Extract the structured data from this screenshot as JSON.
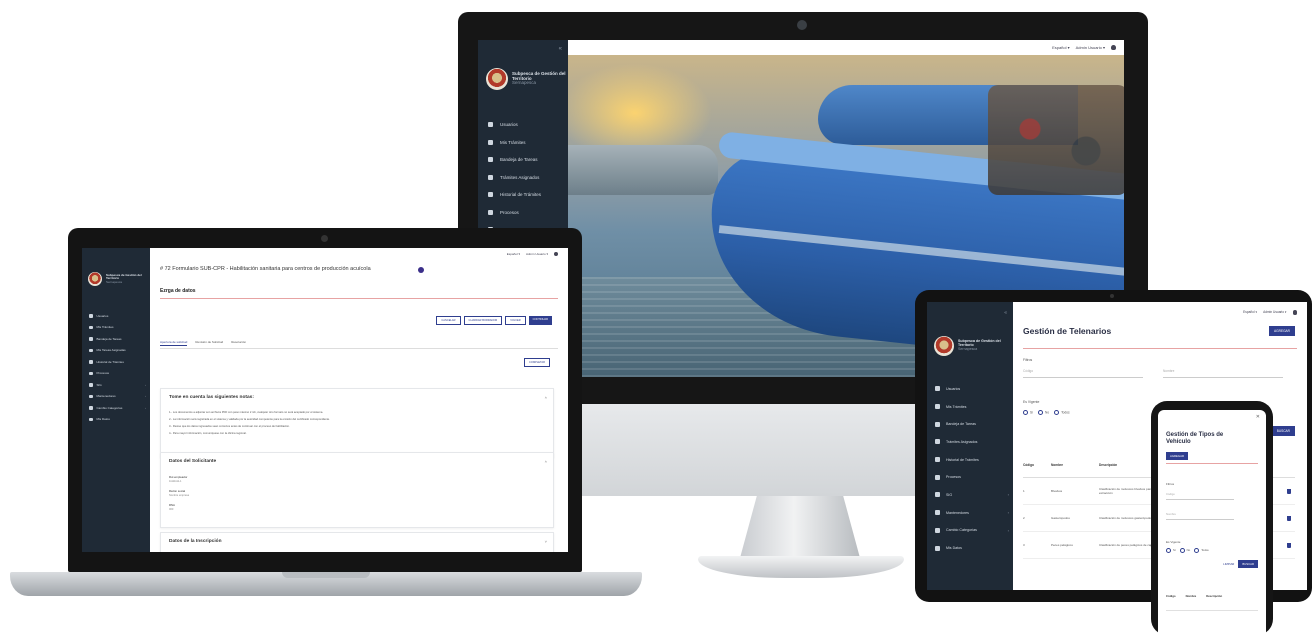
{
  "colors": {
    "sidebar": "#1f2a36",
    "primary": "#2f3e8f",
    "accent_line": "#e7a3a3"
  },
  "brand": {
    "title": "Subpesca de Gestión del Territorio",
    "sub": "Sernapesca"
  },
  "monitor": {
    "topbar": {
      "lang": "Español ▾",
      "user": "Admin Usuario ▾"
    },
    "menu": [
      {
        "label": "Usuarios",
        "icon": "users-icon"
      },
      {
        "label": "Mis Trámites",
        "icon": "documents-icon"
      },
      {
        "label": "Bandeja de Tareas",
        "icon": "inbox-icon"
      },
      {
        "label": "Trámites Asignados",
        "icon": "assigned-icon"
      },
      {
        "label": "Historial de Trámites",
        "icon": "history-icon"
      },
      {
        "label": "Procesos",
        "icon": "process-icon"
      },
      {
        "label": "SIG",
        "icon": "map-icon"
      }
    ]
  },
  "laptop": {
    "topbar": {
      "lang": "Español ▾",
      "user": "Admin Usuario ▾"
    },
    "menu": [
      {
        "label": "Usuarios"
      },
      {
        "label": "Mis Trámites"
      },
      {
        "label": "Bandeja de Tareas"
      },
      {
        "label": "Mis Tareas Asignadas"
      },
      {
        "label": "Historial de Trámites"
      },
      {
        "label": "Procesos"
      },
      {
        "label": "SIG"
      },
      {
        "label": "Mantenedores"
      },
      {
        "label": "Cambio Categorías"
      },
      {
        "label": "Mis Datos"
      }
    ],
    "title": "# 72 Formulario SUB-CPR - Habilitación sanitaria para centros de producción acuícola",
    "subtitle": "Ezrga de datos",
    "actions": [
      "CANCELAR",
      "GUARDAR BORRADOR",
      "VOLVER",
      "CONTINUAR"
    ],
    "tabs": [
      "Apertura de solicitud",
      "Revisión de Solicitud",
      "Resolución"
    ],
    "small_button": "COMPLETAR",
    "notes_panel": {
      "title": "Tome en cuenta las siguientes notas:",
      "lines": [
        "1.- Los documentos a adjuntar son archivos PDF con peso máximo 2 mb, cualquier otro formato no será aceptado por el sistema.",
        "2.- La información será registrada en el sistema y validada por la autoridad competente para la emisión del certificado correspondiente.",
        "3.- Revise que los datos ingresados sean correctos antes de continuar con el proceso de habilitación.",
        "4.- Para mayor información, comuníquese con la oficina regional."
      ]
    },
    "applicant_panel": {
      "title": "Datos del Solicitante",
      "fields": [
        {
          "label": "Rut empleador",
          "value": "11111111-1"
        },
        {
          "label": "Razón social",
          "value": "Nombre empresa"
        },
        {
          "label": "RNA",
          "value": "000"
        }
      ]
    },
    "inscription_panel": {
      "title": "Datos de la Inscripción"
    }
  },
  "tablet": {
    "topbar": {
      "lang": "Español ▾",
      "user": "Admin Usuario ▾"
    },
    "menu": [
      {
        "label": "Usuarios"
      },
      {
        "label": "Mis Trámites"
      },
      {
        "label": "Bandeja de Tareas"
      },
      {
        "label": "Trámites Asignados"
      },
      {
        "label": "Historial de Trámites"
      },
      {
        "label": "Procesos"
      },
      {
        "label": "SIG"
      },
      {
        "label": "Mantenedores"
      },
      {
        "label": "Cambio Categorías"
      },
      {
        "label": "Mis Datos"
      }
    ],
    "title": "Gestión de Telenarios",
    "new_button": "AGREGAR",
    "filter_label": "Filtros",
    "inputs": [
      "Código",
      "Nombre"
    ],
    "radio_label": "Es Vigente",
    "radios": [
      "Sí",
      "No",
      "Todos"
    ],
    "search_button": "BUSCAR",
    "columns": [
      "Código",
      "Nombre",
      "Descripción"
    ],
    "rows": [
      {
        "code": "1",
        "name": "Bivalvos",
        "desc": "Clasificación de moluscos bivalvos para extracción"
      },
      {
        "code": "2",
        "name": "Gasterópodos",
        "desc": "Clasificación de moluscos gasterópodos"
      },
      {
        "code": "3",
        "name": "Peces pelágicos",
        "desc": "Clasificación de peces pelágicos de captura"
      }
    ]
  },
  "phone": {
    "title": "Gestión de Tipos de Vehículo",
    "new_button": "AGREGAR",
    "filter_label": "Filtros",
    "inputs": [
      "Código",
      "Nombre"
    ],
    "radio_label": "Es Vigente",
    "radios": [
      "Sí",
      "No",
      "Todos"
    ],
    "clear_button": "LIMPIAR",
    "search_button": "BUSCAR",
    "columns": [
      "Código",
      "Nombre",
      "Descripción"
    ]
  }
}
